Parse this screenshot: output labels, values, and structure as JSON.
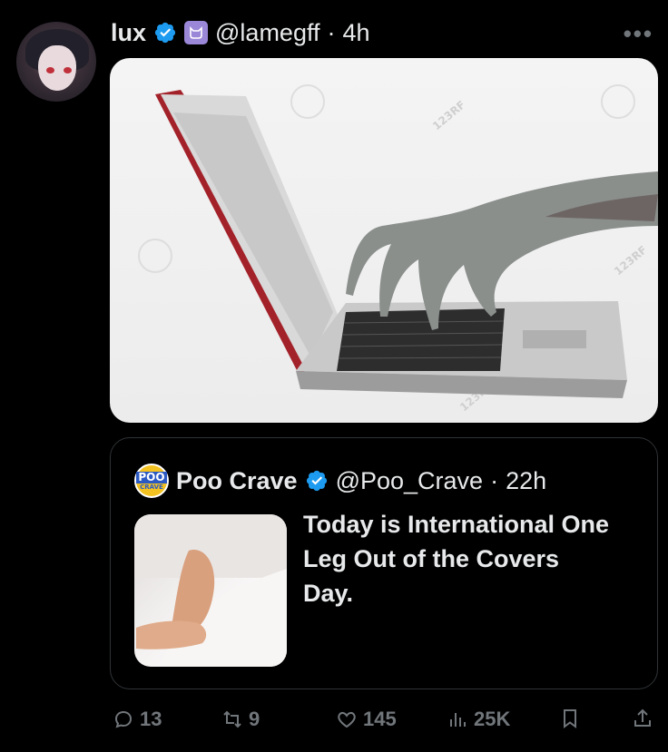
{
  "tweet": {
    "display_name": "lux",
    "handle": "@lamegff",
    "separator": "·",
    "time": "4h",
    "more_label": "•••",
    "media_watermark": "123RF"
  },
  "quote": {
    "display_name": "Poo Crave",
    "handle": "@Poo_Crave",
    "separator": "·",
    "time": "22h",
    "logo_text_top": "POO",
    "logo_text_bottom": "CRAVE",
    "text": "Today is International One Leg Out of the Covers Day."
  },
  "actions": {
    "replies": "13",
    "retweets": "9",
    "likes": "145",
    "views": "25K"
  },
  "colors": {
    "background": "#000000",
    "text": "#e7e9ea",
    "muted": "#71767b",
    "verified": "#1d9bf0",
    "border": "#2f3336"
  }
}
